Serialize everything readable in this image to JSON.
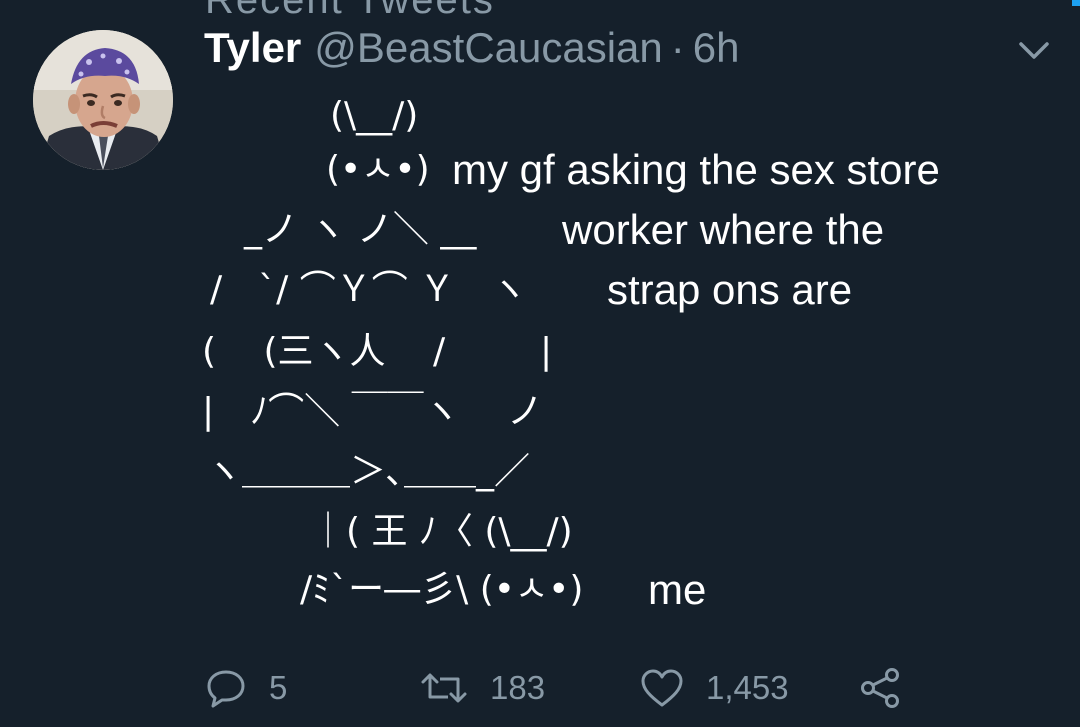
{
  "timeline": {
    "above_text": "Recent Tweets"
  },
  "tweet": {
    "author": {
      "name": "Tyler",
      "handle": "@BeastCaucasian"
    },
    "separator": "·",
    "time": "6h",
    "body_lines": [
      {
        "text": "(\\__/)"
      },
      {
        "text": "(•ㅅ•)"
      },
      {
        "text": "my gf asking the sex store"
      },
      {
        "text": "_ノ ヽ ノ＼ __"
      },
      {
        "text": "worker where the"
      },
      {
        "text": "/　`/ ⌒Ｙ⌒ Ｙ　ヽ"
      },
      {
        "text": "strap ons are"
      },
      {
        "text": "( 　(三ヽ人　 /　 　 |"
      },
      {
        "text": "|　ﾉ⌒＼ ￣￣ヽ　 ノ"
      },
      {
        "text": "ヽ＿＿＿＞､＿＿_／"
      },
      {
        "text": "｜( 王 ﾉ〈 (\\__/)"
      },
      {
        "text": "/ﾐ`ー―彡\\ (•ㅅ•)"
      },
      {
        "text": "me"
      }
    ],
    "stats": {
      "replies": "5",
      "retweets": "183",
      "likes": "1,453"
    }
  },
  "icons": {
    "reply": "reply-icon",
    "retweet": "retweet-icon",
    "like": "heart-icon",
    "share": "share-icon",
    "more": "chevron-down-icon"
  },
  "colors": {
    "background": "#15202b",
    "primary_text": "#ffffff",
    "secondary_text": "#8899a6",
    "accent": "#1da1f2"
  }
}
